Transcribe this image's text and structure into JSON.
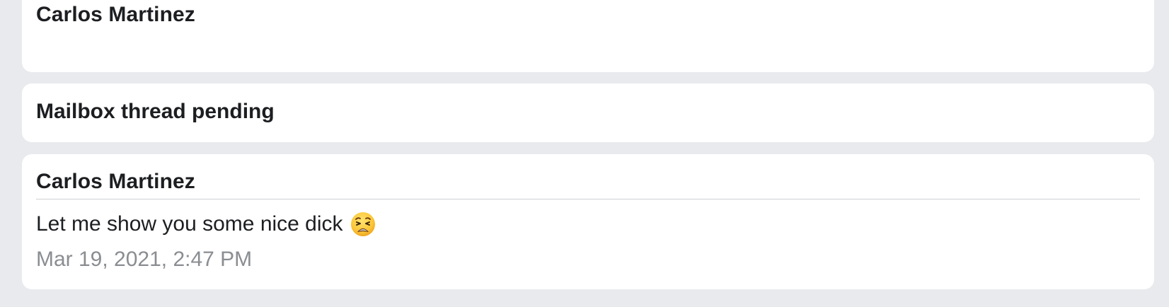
{
  "cards": [
    {
      "name": "Carlos Martinez"
    },
    {
      "title": "Mailbox thread pending"
    },
    {
      "name": "Carlos Martinez",
      "message": "Let me show you some nice dick",
      "emoji": "weary-face-icon",
      "timestamp": "Mar 19, 2021, 2:47 PM"
    }
  ],
  "colors": {
    "background": "#e9eaed",
    "card": "#ffffff",
    "text": "#1c1e21",
    "muted": "#8a8d91"
  }
}
